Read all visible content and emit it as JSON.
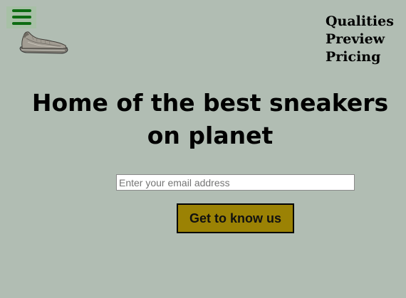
{
  "header": {
    "menu_icon": "hamburger-menu-icon",
    "logo_icon": "sneaker-logo-icon"
  },
  "nav": {
    "items": [
      "Qualities",
      "Preview",
      "Pricing"
    ]
  },
  "hero": {
    "headline": "Home of the best sneakers on planet"
  },
  "signup": {
    "email_placeholder": "Enter your email address",
    "email_value": "",
    "cta_label": "Get to know us"
  },
  "colors": {
    "background": "#b1bdb3",
    "menu_button_bg": "#a7c0a6",
    "menu_bars": "#0d6b12",
    "cta_bg": "#9b8204"
  }
}
